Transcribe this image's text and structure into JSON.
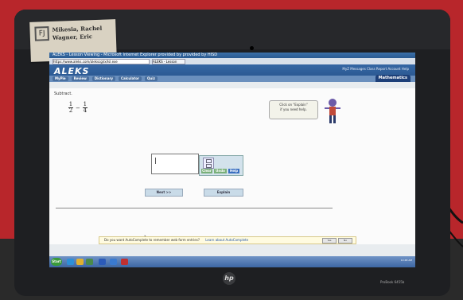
{
  "sticker": {
    "logo": "FJ",
    "line1": "Mikesia, Rachel",
    "line2": "Wagner, Eric"
  },
  "browser": {
    "title": "ALEKS - Lesson Viewing - Microsoft Internet Explorer provided by provided by HISD",
    "address": "https://www.aleks.com/alekscgi/x/Isl.exe",
    "tab_label": "ALEKS - Lesson Viewing"
  },
  "aleks": {
    "logo": "ALEKS",
    "toplinks": "MyZ  Messages  Class  Report  Account  Help",
    "nav_tabs": [
      "MyPie",
      "Review",
      "Dictionary",
      "Calculator",
      "Quiz"
    ],
    "subject_tab": "Mathematics"
  },
  "problem": {
    "instruction": "Subtract.",
    "frac1_num": "1",
    "frac1_den": "2",
    "operator": "−",
    "frac2_num": "1",
    "frac2_den": "4"
  },
  "tip": {
    "line1": "Click on \"Explain\"",
    "line2": "if you need help."
  },
  "tools": {
    "clear": "Clear",
    "undo": "Undo",
    "help": "Help"
  },
  "buttons": {
    "next": "Next >>",
    "explain": "Explain"
  },
  "infobar": {
    "text": "Do you want AutoComplete to remember web form entries?",
    "link": "Learn about AutoComplete",
    "yes": "Yes",
    "no": "No"
  },
  "taskbar": {
    "start": "Start",
    "time": "10:48 AM"
  },
  "laptop": {
    "brand": "hp",
    "model": "ProBook 6455b"
  },
  "colors": {
    "aleks_blue": "#27528a",
    "border_red": "#b8262b",
    "help_blue": "#3a6fc0",
    "tool_green": "#7ab07a"
  }
}
